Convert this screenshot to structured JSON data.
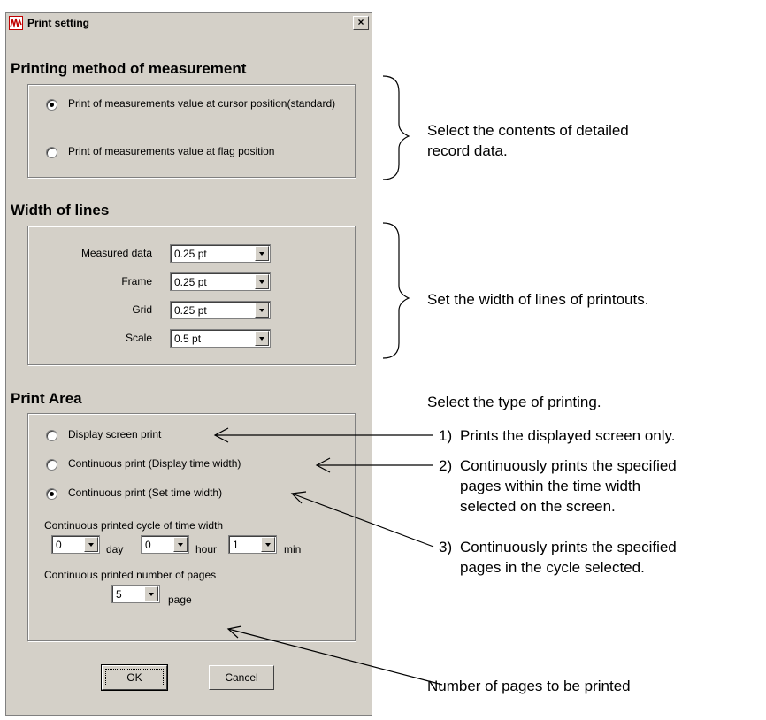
{
  "dialog": {
    "title": "Print setting",
    "close_label": "×"
  },
  "method": {
    "title": "Printing method of measurement",
    "options": [
      {
        "label": "Print of measurements value at cursor position(standard)",
        "checked": true
      },
      {
        "label": "Print of measurements value at flag position",
        "checked": false
      }
    ]
  },
  "lines": {
    "title": "Width of lines",
    "rows": [
      {
        "label": "Measured data",
        "value": "0.25 pt"
      },
      {
        "label": "Frame",
        "value": "0.25 pt"
      },
      {
        "label": "Grid",
        "value": "0.25  pt"
      },
      {
        "label": "Scale",
        "value": "0.5   pt"
      }
    ]
  },
  "area": {
    "title": "Print Area",
    "options": [
      {
        "label": "Display screen print",
        "checked": false
      },
      {
        "label": "Continuous print (Display time width)",
        "checked": false
      },
      {
        "label": "Continuous print (Set time width)",
        "checked": true
      }
    ],
    "cycle_label": "Continuous printed cycle of time width",
    "day_value": "0",
    "day_unit": "day",
    "hour_value": "0",
    "hour_unit": "hour",
    "min_value": "1",
    "min_unit": "min",
    "pages_label": "Continuous printed number of pages",
    "pages_value": "5",
    "pages_unit": "page"
  },
  "buttons": {
    "ok": "OK",
    "cancel": "Cancel"
  },
  "annotations": {
    "method_line1": "Select the contents of detailed",
    "method_line2": "record data.",
    "lines_note": "Set the width of lines of printouts.",
    "area_note": "Select the type of printing.",
    "n1": "1)",
    "t1": "Prints the displayed screen only.",
    "n2": "2)",
    "t2a": "Continuously prints the specified",
    "t2b": "pages within the time width",
    "t2c": "selected on the screen.",
    "n3": "3)",
    "t3a": "Continuously prints the specified",
    "t3b": "pages in the cycle selected.",
    "pages_note": "Number of pages to be printed"
  }
}
